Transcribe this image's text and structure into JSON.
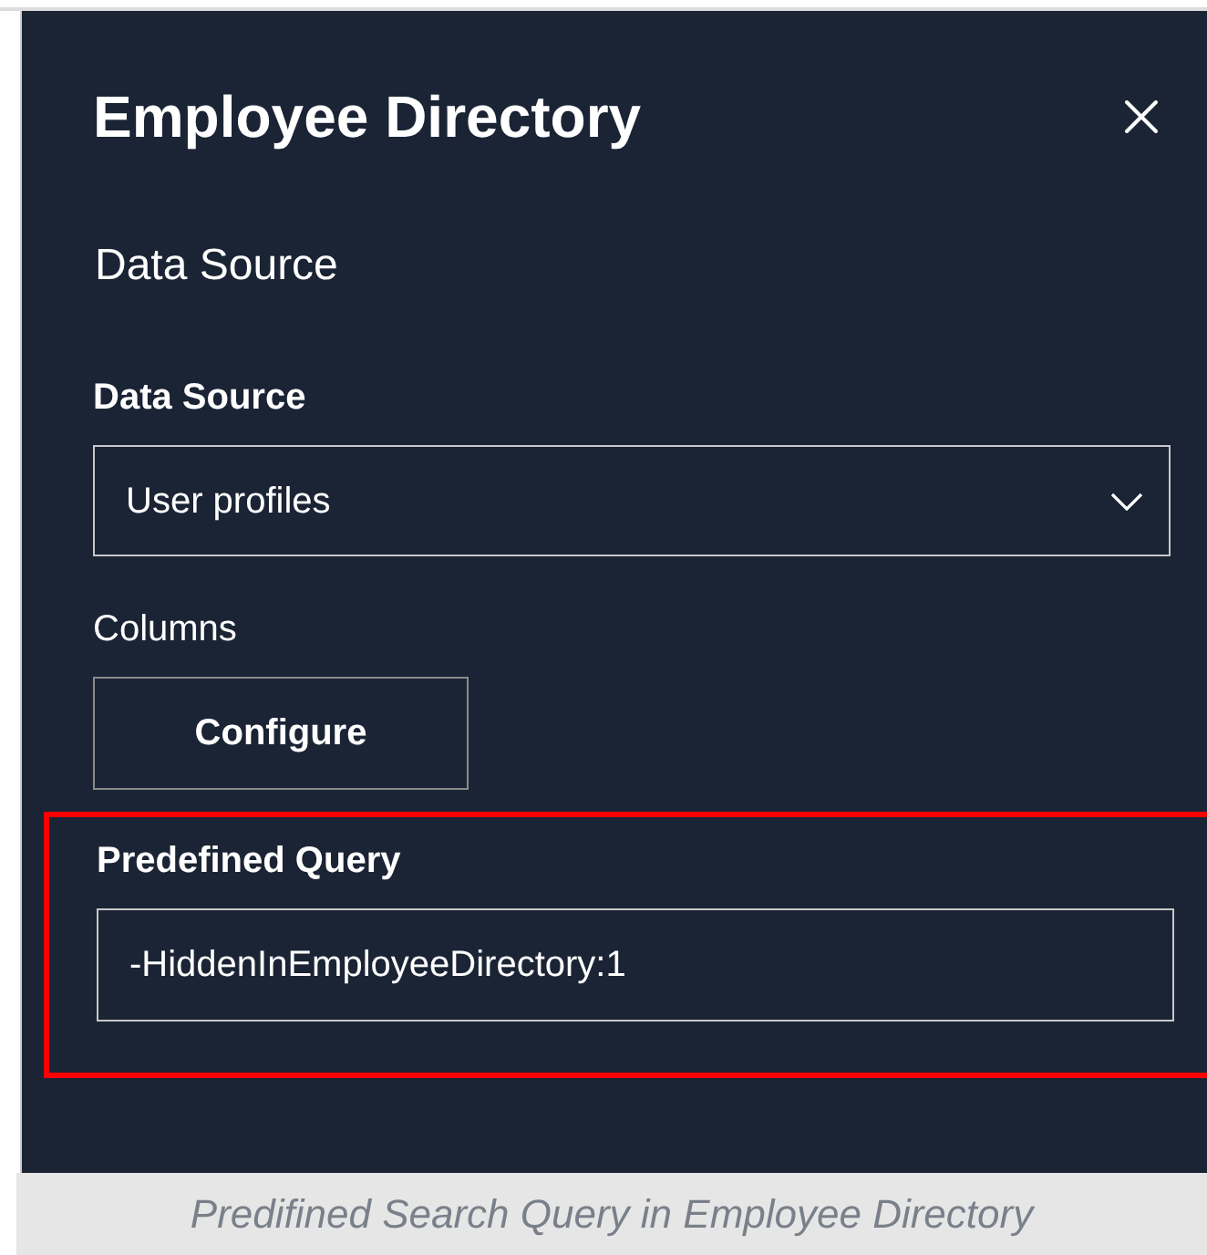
{
  "panel": {
    "title": "Employee Directory",
    "section_heading": "Data Source",
    "data_source": {
      "label": "Data Source",
      "value": "User profiles"
    },
    "columns": {
      "label": "Columns",
      "button": "Configure"
    },
    "predefined_query": {
      "label": "Predefined Query",
      "value": "-HiddenInEmployeeDirectory:1",
      "highlighted": true
    }
  },
  "caption": "Predifined Search Query in Employee Directory"
}
